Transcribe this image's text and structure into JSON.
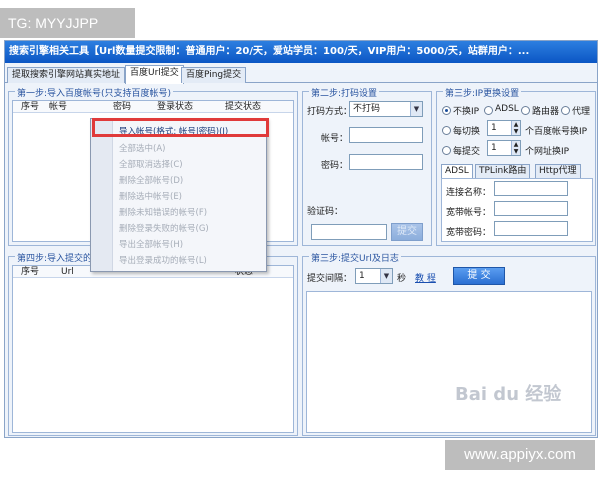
{
  "overlay": {
    "tg_label": "TG: MYYJJPP",
    "site_watermark": "www.appiyx.com",
    "baidu_watermark": "Bai du 经验"
  },
  "window": {
    "title": "搜索引擎相关工具【Url数量提交限制：普通用户：20/天，爱站学员：100/天，VIP用户：5000/天，站群用户：..."
  },
  "tabs": [
    {
      "label": "提取搜索引擎网站真实地址"
    },
    {
      "label": "百度Url提交"
    },
    {
      "label": "百度Ping提交"
    }
  ],
  "step1": {
    "title": "第一步:导入百度帐号(只支持百度帐号)",
    "columns": [
      "序号",
      "帐号",
      "密码",
      "登录状态",
      "提交状态"
    ]
  },
  "step2": {
    "title": "第二步:打码设置",
    "mode_label": "打码方式：",
    "mode_value": "不打码",
    "account_label": "帐号：",
    "password_label": "密码：",
    "captcha_label": "验证码：",
    "submit_label": "提交"
  },
  "step3ip": {
    "title": "第三步:IP更换设置",
    "radio_options": [
      "不换IP",
      "ADSL",
      "路由器",
      "代理"
    ],
    "switch_label": "每切换",
    "switch_value": "1",
    "switch_suffix": "个百度帐号换IP",
    "submit_label": "每提交",
    "submit_value": "1",
    "submit_suffix": "个网址换IP",
    "inner_tabs": [
      "ADSL",
      "TPLink路由",
      "Http代理"
    ],
    "conn_name_label": "连接名称：",
    "broadband_account_label": "宽带帐号：",
    "broadband_password_label": "宽带密码："
  },
  "step4": {
    "title": "第四步:导入提交的Url",
    "columns": [
      "序号",
      "Url",
      "状态"
    ]
  },
  "step3log": {
    "title": "第三步:提交Url及日志",
    "interval_label": "提交间隔：",
    "interval_value": "1",
    "interval_unit": "秒",
    "tutorial_label": "教 程",
    "submit_label": "提 交"
  },
  "context_menu": {
    "items": [
      "导入帐号(格式: 帐号|密码)(I)",
      "全部选中(A)",
      "全部取消选择(C)",
      "删除全部帐号(D)",
      "删除选中帐号(E)",
      "删除未知错误的帐号(F)",
      "删除登录失败的帐号(G)",
      "导出全部帐号(H)",
      "导出登录成功的帐号(L)"
    ]
  }
}
